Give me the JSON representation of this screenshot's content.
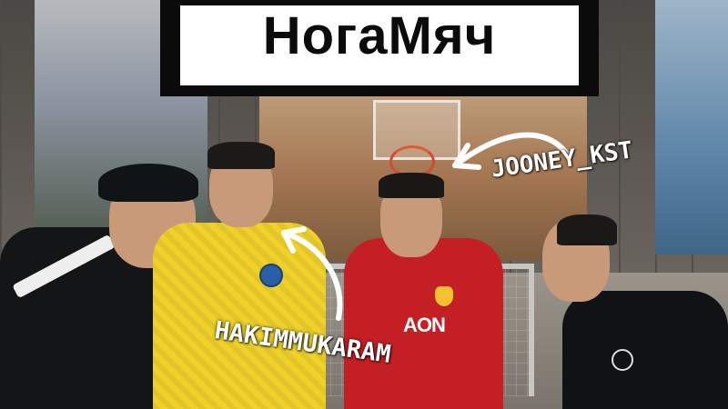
{
  "thumbnail": {
    "title": "НогаМяч",
    "labels": {
      "top_right": "JOONEY_KST",
      "bottom_center": "HAKIMMUKARAM"
    },
    "jersey_sponsor": "AON",
    "colors": {
      "title_background": "#0b0b0b",
      "title_panel": "#ffffff",
      "title_text": "#0b0b0b",
      "label_text": "#ffffff",
      "yellow_jersey": "#f0d12a",
      "red_jersey": "#c41f25"
    }
  }
}
